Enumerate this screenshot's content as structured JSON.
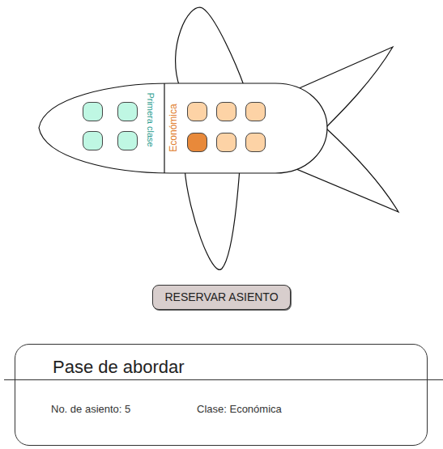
{
  "first_class": {
    "label": "Primera clase",
    "seats": [
      {
        "selected": false
      },
      {
        "selected": false
      },
      {
        "selected": false
      },
      {
        "selected": false
      }
    ]
  },
  "economy": {
    "label": "Económica",
    "seats": [
      {
        "selected": false
      },
      {
        "selected": false
      },
      {
        "selected": false
      },
      {
        "selected": true
      },
      {
        "selected": false
      },
      {
        "selected": false
      }
    ]
  },
  "reserve_button": "RESERVAR ASIENTO",
  "boarding_pass": {
    "title": "Pase de abordar",
    "seat": "No. de asiento: 5",
    "class": "Clase: Económica"
  }
}
